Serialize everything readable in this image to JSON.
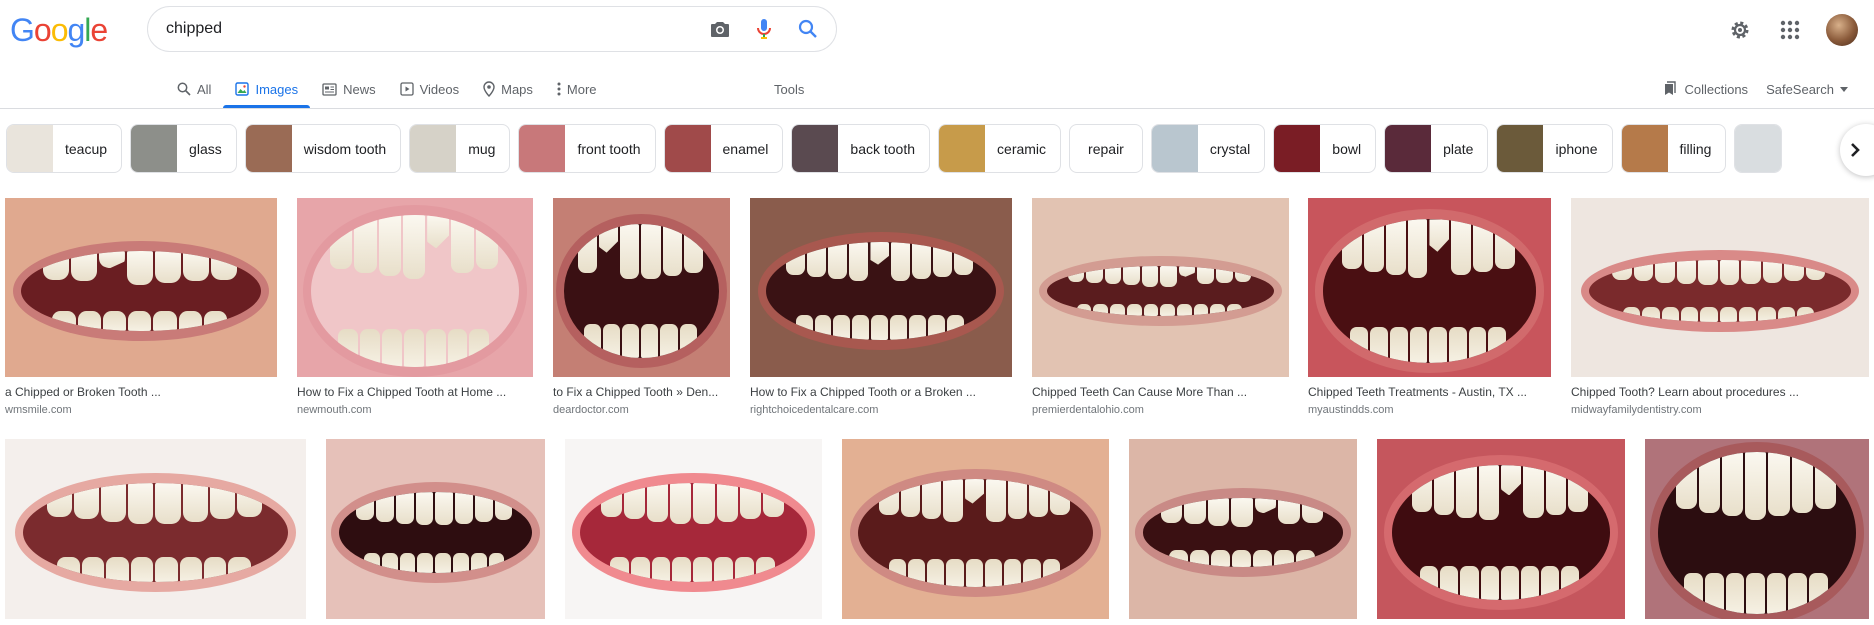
{
  "app": {
    "logo_letters": [
      {
        "ch": "G",
        "color": "#4285F4"
      },
      {
        "ch": "o",
        "color": "#EA4335"
      },
      {
        "ch": "o",
        "color": "#FBBC05"
      },
      {
        "ch": "g",
        "color": "#4285F4"
      },
      {
        "ch": "l",
        "color": "#34A853"
      },
      {
        "ch": "e",
        "color": "#EA4335"
      }
    ]
  },
  "search": {
    "value": "chipped",
    "icons": [
      "camera-icon",
      "microphone-icon",
      "search-icon"
    ]
  },
  "header_right": {
    "icons": [
      "settings-icon",
      "apps-grid-icon"
    ]
  },
  "tabs": [
    {
      "label": "All",
      "icon": "search-icon",
      "active": false
    },
    {
      "label": "Images",
      "icon": "image-icon",
      "active": true
    },
    {
      "label": "News",
      "icon": "news-icon",
      "active": false
    },
    {
      "label": "Videos",
      "icon": "video-icon",
      "active": false
    },
    {
      "label": "Maps",
      "icon": "map-pin-icon",
      "active": false
    },
    {
      "label": "More",
      "icon": "more-vert-icon",
      "active": false
    }
  ],
  "tools_label": "Tools",
  "collections_label": "Collections",
  "safesearch_label": "SafeSearch",
  "chips": [
    {
      "label": "teacup",
      "thumb": "#e9e4dc"
    },
    {
      "label": "glass",
      "thumb": "#8d8f8a"
    },
    {
      "label": "wisdom tooth",
      "thumb": "#9a6b55"
    },
    {
      "label": "mug",
      "thumb": "#d6d2c8"
    },
    {
      "label": "front tooth",
      "thumb": "#c8787a"
    },
    {
      "label": "enamel",
      "thumb": "#a04a4a"
    },
    {
      "label": "back tooth",
      "thumb": "#5a4a50"
    },
    {
      "label": "ceramic",
      "thumb": "#c79b4a"
    },
    {
      "label": "repair",
      "thumb": ""
    },
    {
      "label": "crystal",
      "thumb": "#b9c6cf"
    },
    {
      "label": "bowl",
      "thumb": "#7a1d25"
    },
    {
      "label": "plate",
      "thumb": "#5a2a3a"
    },
    {
      "label": "iphone",
      "thumb": "#6b5a3a"
    },
    {
      "label": "filling",
      "thumb": "#b57a4a"
    },
    {
      "label": "",
      "thumb": "#d9dde0"
    }
  ],
  "results_row1": [
    {
      "title": "a Chipped or Broken Tooth ...",
      "source": "wmsmile.com"
    },
    {
      "title": "How to Fix a Chipped Tooth at Home ...",
      "source": "newmouth.com"
    },
    {
      "title": "to Fix a Chipped Tooth » Den...",
      "source": "deardoctor.com"
    },
    {
      "title": "How to Fix a Chipped Tooth or a Broken ...",
      "source": "rightchoicedentalcare.com"
    },
    {
      "title": "Chipped Teeth Can Cause More Than ...",
      "source": "premierdentalohio.com"
    },
    {
      "title": "Chipped Teeth Treatments - Austin, TX ...",
      "source": "myaustindds.com"
    },
    {
      "title": "Chipped Tooth? Learn about procedures ...",
      "source": "midwayfamilydentistry.com"
    }
  ],
  "results_row2_count": 7
}
